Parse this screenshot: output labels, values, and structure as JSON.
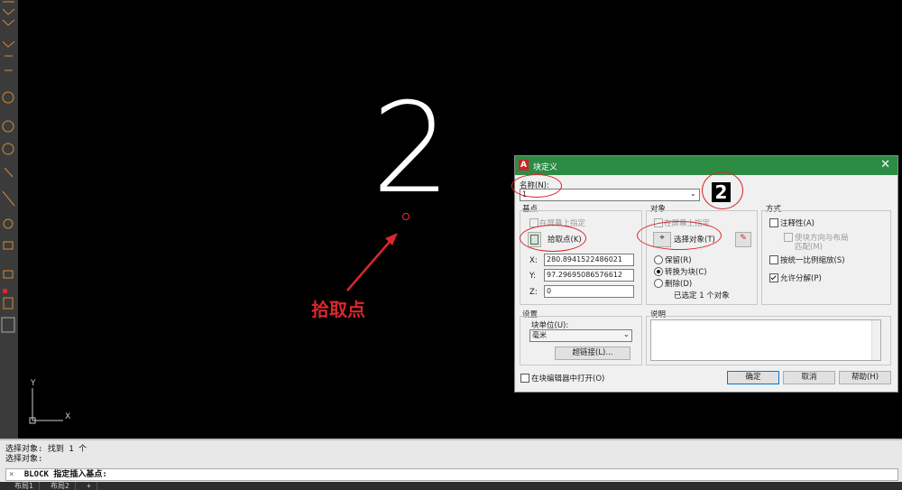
{
  "canvas": {
    "drawn_text": "2",
    "annotation_label": "拾取点",
    "ucs_x": "X",
    "ucs_y": "Y"
  },
  "dialog": {
    "title": "块定义",
    "name_label": "名称(N):",
    "name_value": "1",
    "preview_text": "2",
    "basepoint": {
      "group_label": "基点",
      "on_screen": "在屏幕上指定",
      "pick_button": "拾取点(K)",
      "x_label": "X:",
      "x_value": "280.8941522486021",
      "y_label": "Y:",
      "y_value": "97.29695086576612",
      "z_label": "Z:",
      "z_value": "0"
    },
    "objects": {
      "group_label": "对象",
      "on_screen": "在屏幕上指定",
      "select_button": "选择对象(T)",
      "retain": "保留(R)",
      "convert": "转换为块(C)",
      "delete": "删除(D)",
      "status": "已选定 1 个对象"
    },
    "behavior": {
      "group_label": "方式",
      "annotative": "注释性(A)",
      "match_orientation": "使块方向与布局",
      "match_orientation_2": "匹配(M)",
      "uniform_scale": "按统一比例缩放(S)",
      "allow_explode": "允许分解(P)"
    },
    "settings": {
      "group_label": "设置",
      "unit_label": "块单位(U):",
      "unit_value": "毫米",
      "hyperlink_button": "超链接(L)..."
    },
    "description": {
      "group_label": "说明"
    },
    "open_in_editor": "在块编辑器中打开(O)",
    "ok": "确定",
    "cancel": "取消",
    "help": "帮助(H)"
  },
  "command": {
    "history_1": "选择对象: 找到 1 个",
    "history_2": "选择对象:",
    "prompt": "BLOCK 指定插入基点:"
  },
  "layout_tabs": [
    "布局1",
    "布局2",
    "+"
  ],
  "colors": {
    "title_bar": "#2c8c44",
    "annotation": "#d8282d"
  }
}
